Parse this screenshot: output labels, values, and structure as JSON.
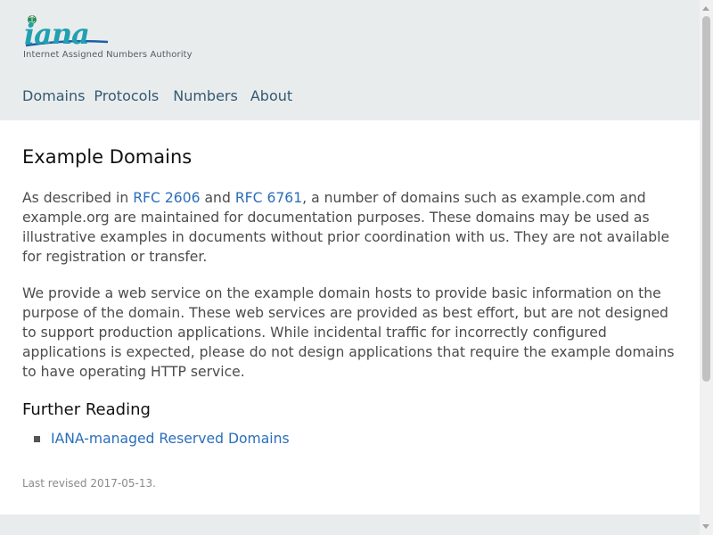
{
  "header": {
    "logo": {
      "wordmark": "iana",
      "tagline": "Internet Assigned Numbers Authority"
    },
    "nav": [
      {
        "label": "Domains"
      },
      {
        "label": "Protocols"
      },
      {
        "label": "Numbers"
      },
      {
        "label": "About"
      }
    ]
  },
  "main": {
    "title": "Example Domains",
    "paragraph1": {
      "prefix": "As described in ",
      "link1": "RFC 2606",
      "middle": " and ",
      "link2": "RFC 6761",
      "suffix": ", a number of domains such as example.com and example.org are maintained for documentation purposes. These domains may be used as illustrative examples in documents without prior coordination with us. They are not available for registration or transfer."
    },
    "paragraph2": "We provide a web service on the example domain hosts to provide basic information on the purpose of the domain. These web services are provided as best effort, but are not designed to support production applications. While incidental traffic for incorrectly configured applications is expected, please do not design applications that require the example domains to have operating HTTP service.",
    "further_reading": {
      "heading": "Further Reading",
      "links": [
        {
          "label": "IANA-managed Reserved Domains"
        }
      ]
    },
    "revised": "Last revised 2017-05-13."
  },
  "colors": {
    "header_bg": "#e9eced",
    "nav_text": "#345a70",
    "link": "#2a6ebb",
    "logo_teal": "#21a0b0"
  }
}
